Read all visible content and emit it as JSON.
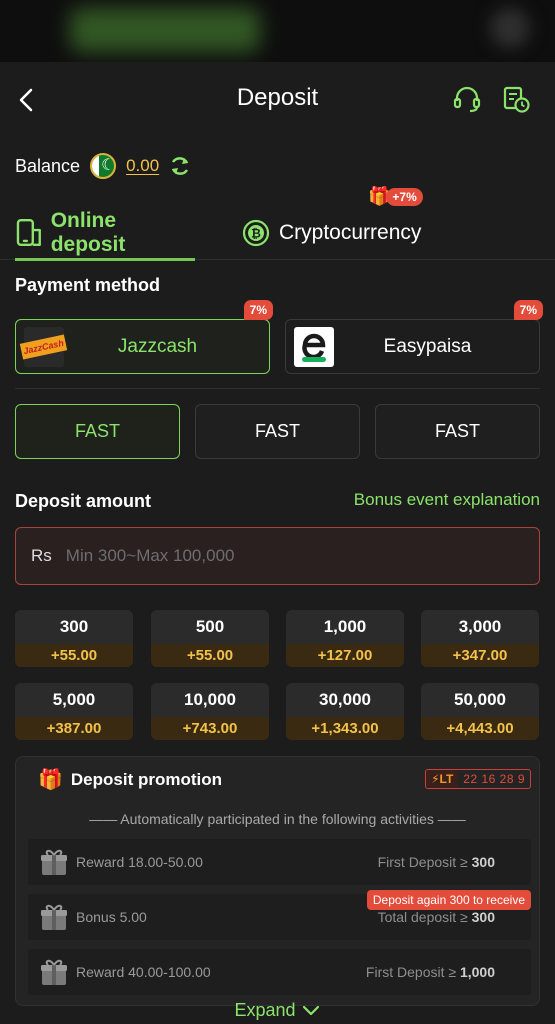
{
  "header": {
    "title": "Deposit"
  },
  "balance": {
    "label": "Balance",
    "value": "0.00"
  },
  "tabs": [
    {
      "label": "Online deposit",
      "active": true
    },
    {
      "label": "Cryptocurrency",
      "active": false,
      "bonus": "+7%"
    }
  ],
  "payment": {
    "title": "Payment method",
    "methods": [
      {
        "name": "Jazzcash",
        "badge": "7%",
        "logo_text": "JazzCash",
        "selected": true
      },
      {
        "name": "Easypaisa",
        "badge": "7%",
        "selected": false
      }
    ],
    "channels": [
      "FAST",
      "FAST",
      "FAST"
    ]
  },
  "deposit": {
    "title": "Deposit amount",
    "bonus_link": "Bonus event explanation",
    "currency": "Rs",
    "placeholder": "Min 300~Max 100,000",
    "amounts": [
      {
        "value": "300",
        "bonus": "+55.00"
      },
      {
        "value": "500",
        "bonus": "+55.00"
      },
      {
        "value": "1,000",
        "bonus": "+127.00"
      },
      {
        "value": "3,000",
        "bonus": "+347.00"
      },
      {
        "value": "5,000",
        "bonus": "+387.00"
      },
      {
        "value": "10,000",
        "bonus": "+743.00"
      },
      {
        "value": "30,000",
        "bonus": "+1,343.00"
      },
      {
        "value": "50,000",
        "bonus": "+4,443.00"
      }
    ]
  },
  "promotion": {
    "title": "Deposit promotion",
    "timer_tag": "LT",
    "timer": "22 16 28 9",
    "subtitle": "—— Automatically participated in the following activities ——",
    "tip": "Deposit again 300 to receive",
    "rows": [
      {
        "label": "Reward 18.00-50.00",
        "cond_text": "First Deposit ≥ ",
        "cond_val": "300"
      },
      {
        "label": "Bonus 5.00",
        "cond_text": "Total deposit ≥ ",
        "cond_val": "300"
      },
      {
        "label": "Reward 40.00-100.00",
        "cond_text": "First Deposit ≥ ",
        "cond_val": "1,000"
      }
    ],
    "expand": "Expand"
  },
  "colors": {
    "accent": "#8be36b",
    "gold": "#f3c24a",
    "red": "#e34b3b",
    "bg": "#1c1c1c"
  }
}
